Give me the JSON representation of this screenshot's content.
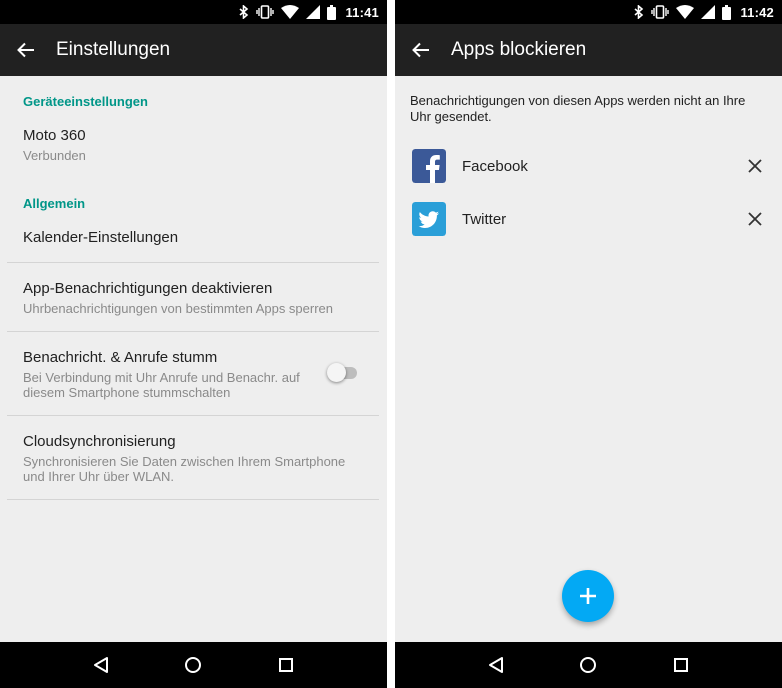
{
  "left": {
    "status": {
      "time": "11:41"
    },
    "app_bar": {
      "title": "Einstellungen"
    },
    "sections": {
      "device": "Geräteeinstellungen",
      "general": "Allgemein"
    },
    "items": {
      "moto360": {
        "title": "Moto 360",
        "summary": "Verbunden"
      },
      "calendar": {
        "title": "Kalender-Einstellungen"
      },
      "app_notifications": {
        "title": "App-Benachrichtigungen deaktivieren",
        "summary": "Uhrbenachrichtigungen von bestimmten Apps sperren"
      },
      "mute": {
        "title": "Benachricht. & Anrufe stumm",
        "summary_line1": "Bei Verbindung mit Uhr Anrufe und Benachr. auf",
        "summary_line2": "diesem Smartphone stummschalten",
        "enabled": false
      },
      "cloud_sync": {
        "title": "Cloudsynchronisierung",
        "summary_line1": "Synchronisieren Sie Daten zwischen Ihrem Smartphone",
        "summary_line2": "und Ihrer Uhr über WLAN."
      }
    }
  },
  "right": {
    "status": {
      "time": "11:42"
    },
    "app_bar": {
      "title": "Apps blockieren"
    },
    "description_line1": "Benachrichtigungen von diesen Apps werden nicht an Ihre",
    "description_line2": "Uhr gesendet.",
    "apps": [
      {
        "name": "Facebook",
        "icon": "facebook-icon",
        "color": "#3b5998"
      },
      {
        "name": "Twitter",
        "icon": "twitter-icon",
        "color": "#2a9fd8"
      }
    ],
    "fab_icon": "plus-icon",
    "fab_color": "#03a9f4"
  },
  "colors": {
    "accent": "#009688",
    "app_bar": "#212121",
    "background": "#eeeeee"
  }
}
